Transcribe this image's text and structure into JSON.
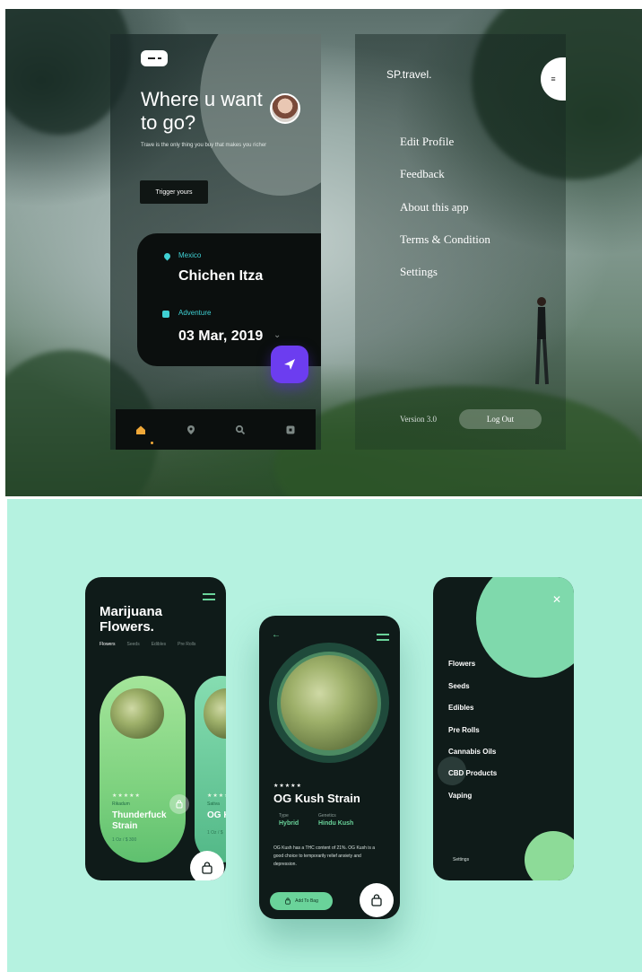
{
  "travel_app": {
    "headline": "Where u want to go?",
    "subtitle": "Trave is the only thing you buy that makes you richer",
    "cta_label": "Trigger yours",
    "location_label": "Mexico",
    "location_name": "Chichen Itza",
    "category_label": "Adventure",
    "date": "03 Mar, 2019",
    "chevron": "⌄",
    "tabs": [
      "home-icon",
      "pin-icon",
      "search-icon",
      "bookmark-icon"
    ]
  },
  "travel_menu": {
    "brand": "SP.travel.",
    "items": [
      "Edit Profile",
      "Feedback",
      "About this app",
      "Terms & Condition",
      "Settings"
    ],
    "version": "Version 3.0",
    "logout_label": "Log Out"
  },
  "flowers_app": {
    "title": "Marijuana Flowers.",
    "tabs": [
      "Flowers",
      "Seeds",
      "Edibles",
      "Pre Rolls"
    ],
    "cards": [
      {
        "stars": "★★★★★",
        "type": "Rikadum",
        "name": "Thunderfuck Strain",
        "price": "1 Oz / $ 300"
      },
      {
        "stars": "★★★★★",
        "type": "Sativa",
        "name": "OG K",
        "price": "1 Oz / $"
      }
    ]
  },
  "product_detail": {
    "stars": "★★★★★",
    "name": "OG Kush Strain",
    "type_label": "Type",
    "type_value": "Hybrid",
    "genetics_label": "Genetics",
    "genetics_value": "Hindu Kush",
    "description": "OG Kush has a THC content of 21%. OG Kush is a good choice to temporarily relief anxiety and depression.",
    "add_to_bag_label": "Add To Bag"
  },
  "shop_menu": {
    "close": "✕",
    "items": [
      "Flowers",
      "Seeds",
      "Edibles",
      "Pre Rolls",
      "Cannabis Oils",
      "CBD Products",
      "Vaping"
    ],
    "settings_label": "Settings"
  },
  "colors": {
    "travel_accent": "#3fd0d3",
    "travel_fab": "#6c3df0",
    "mint_bg": "#b5f2e0",
    "leaf_green": "#6ad39a",
    "phone_dark": "#0f1b19"
  }
}
